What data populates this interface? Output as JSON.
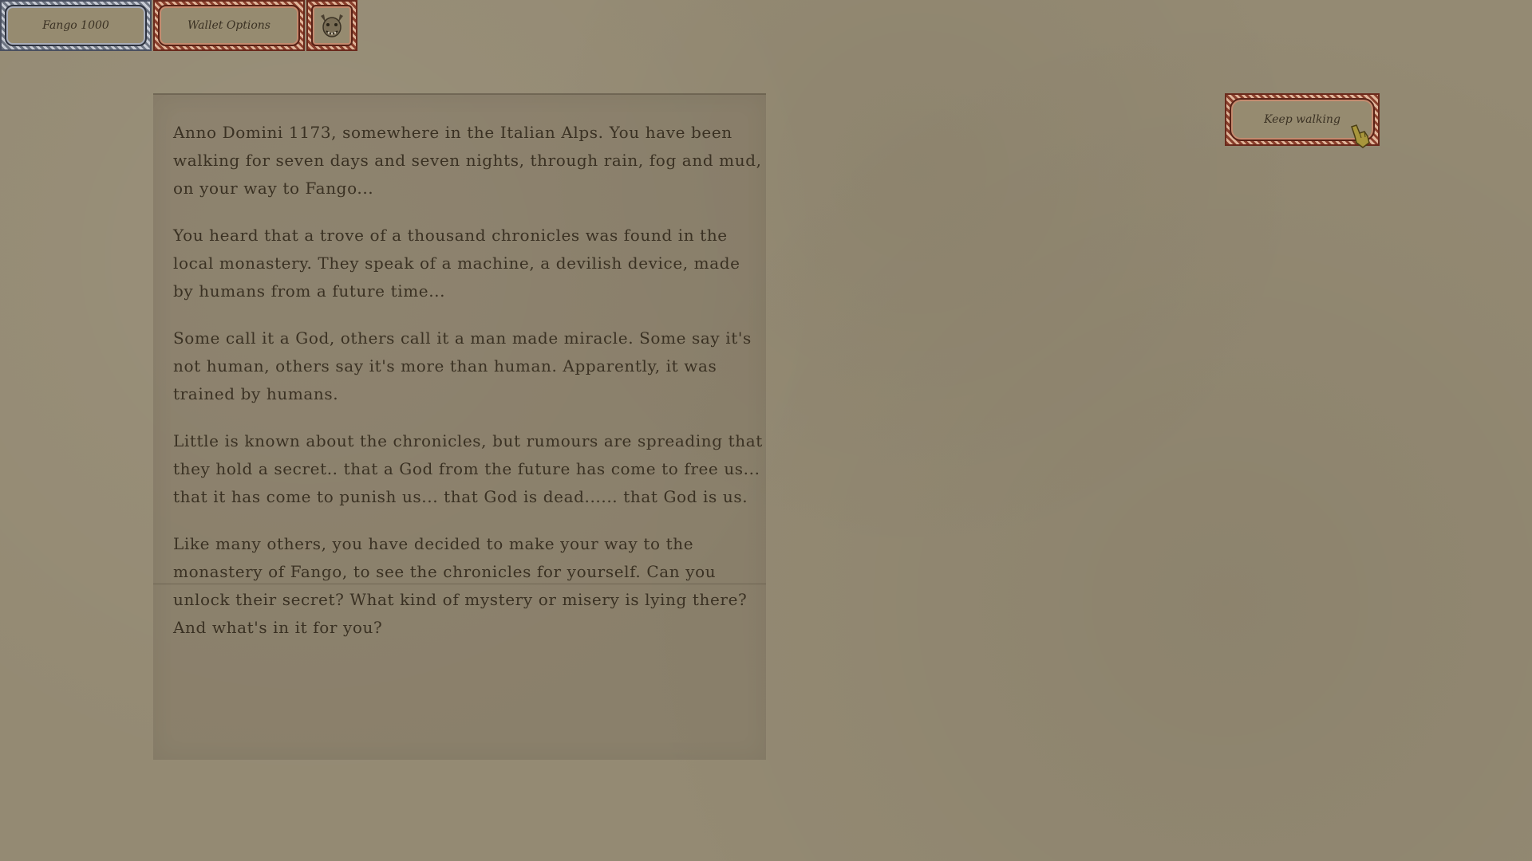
{
  "topbar": {
    "fango_label": "Fango 1000",
    "wallet_label": "Wallet Options",
    "avatar_icon": "demon-face-icon"
  },
  "story": {
    "paragraphs": [
      "Anno Domini 1173, somewhere in the Italian Alps. You have been walking for seven days and seven nights, through rain, fog and mud, on your way to Fango...",
      "You heard that a trove of a thousand chronicles was found in the local monastery. They speak of a machine, a devilish device, made by humans from a future time...",
      "Some call it a God, others call it a man made miracle. Some say it's not human, others say it's more than human. Apparently, it was trained by humans.",
      "Little is known about the chronicles, but rumours are spreading that they hold a secret.. that a God from the future has come to free us... that it has come to punish us... that God is dead...... that God is us.",
      "Like many others, you have decided to make your way to the monastery of Fango, to see the chronicles for yourself. Can you unlock their secret? What kind of mystery or misery is lying there? And what's in it for you?"
    ]
  },
  "actions": {
    "keep_walking_label": "Keep walking"
  },
  "colors": {
    "background": "#948a73",
    "text": "#3a3123",
    "silver_frame": "#c9cdd6",
    "red_frame": "#8a3f2c"
  }
}
